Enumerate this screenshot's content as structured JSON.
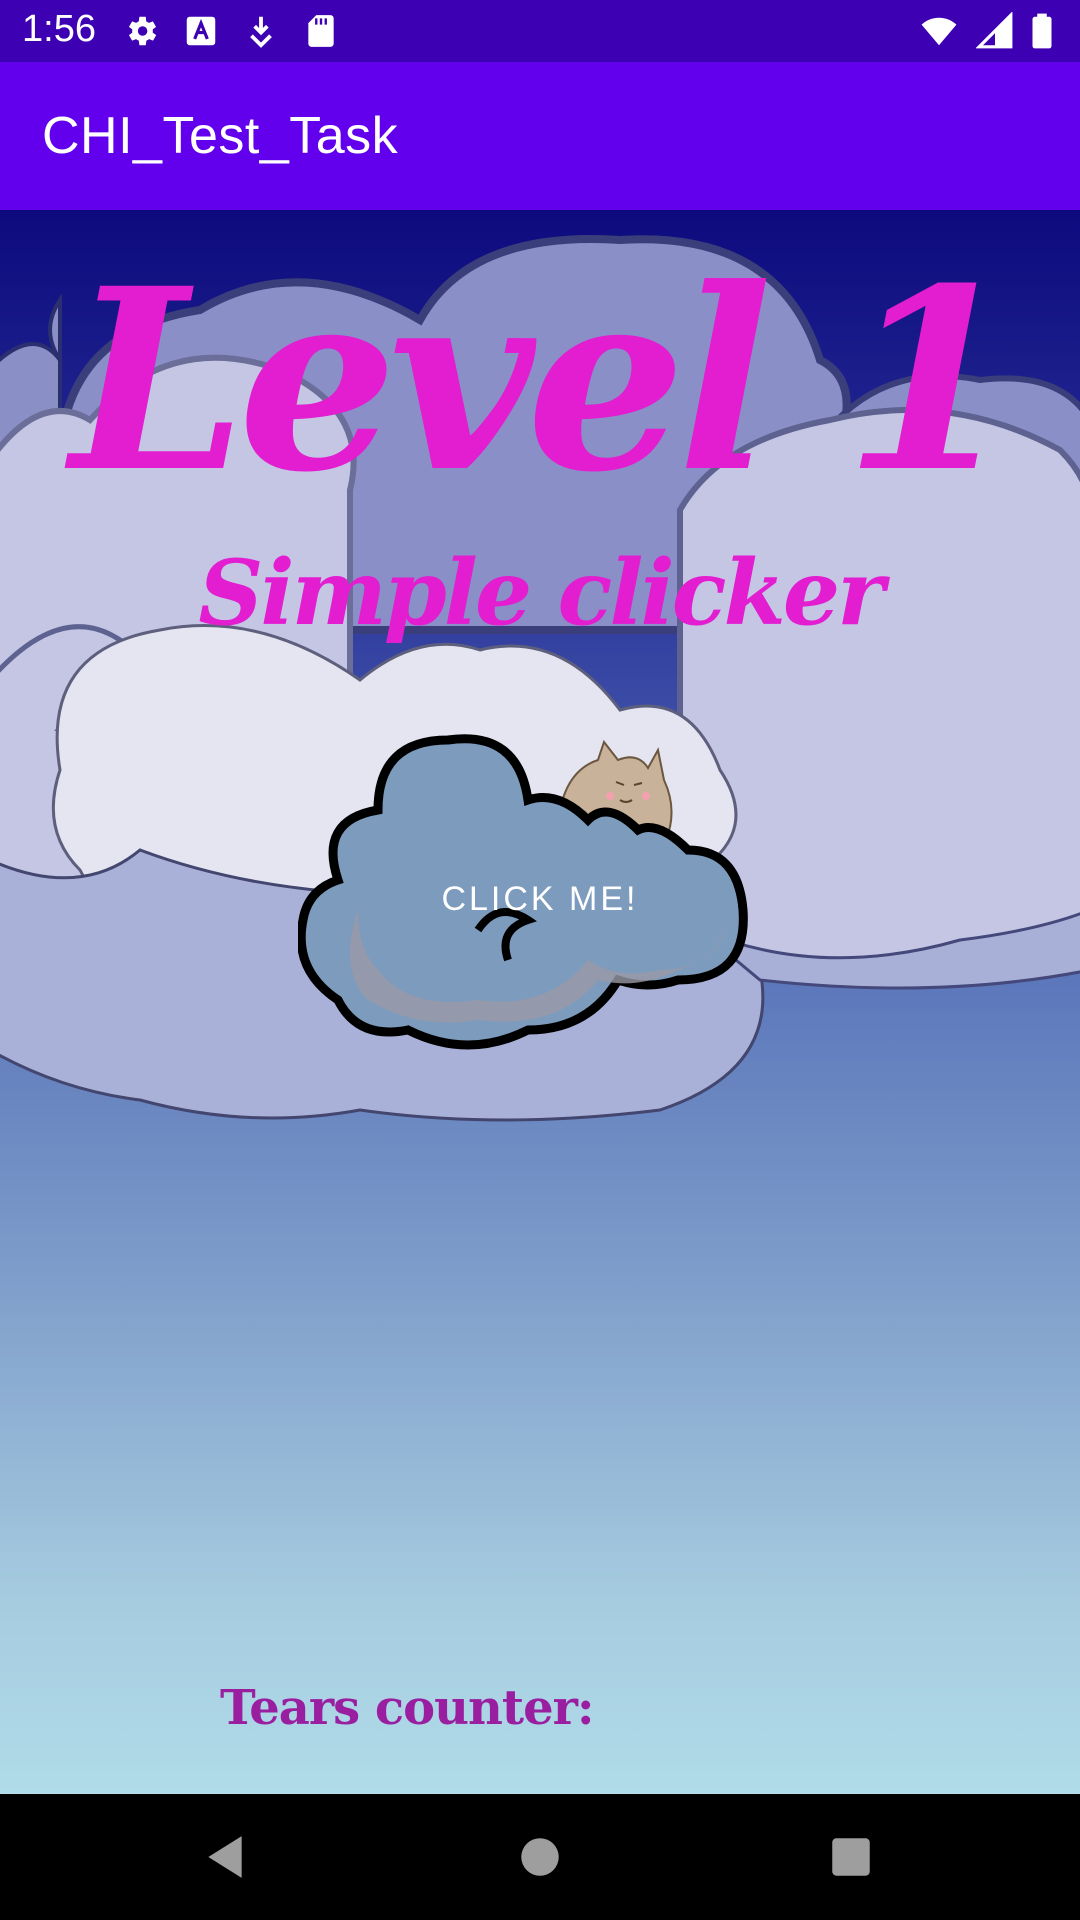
{
  "status_bar": {
    "time": "1:56",
    "left_icons": [
      "gear-icon",
      "a-square-icon",
      "download-arrow-icon",
      "sd-card-icon"
    ],
    "right_icons": [
      "wifi-icon",
      "signal-icon",
      "battery-icon"
    ]
  },
  "app_bar": {
    "title": "CHI_Test_Task"
  },
  "main": {
    "level_title": "Level 1",
    "subtitle": "Simple clicker",
    "click_button_label": "CLICK ME!",
    "counter_label": "Tears counter:"
  },
  "nav_bar": {
    "buttons": [
      "back-icon",
      "home-icon",
      "recents-icon"
    ]
  },
  "colors": {
    "status_bar": "#3e00b3",
    "app_bar": "#6200ee",
    "title_pink": "#e21ed0",
    "counter_purple": "#9a1fa0"
  }
}
